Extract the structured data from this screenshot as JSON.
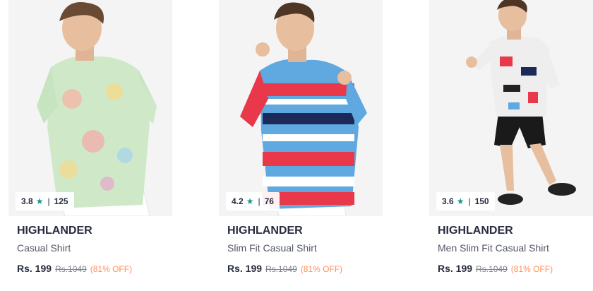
{
  "products": [
    {
      "brand": "HIGHLANDER",
      "name": "Casual Shirt",
      "rating": "3.8",
      "rating_count": "125",
      "price": "Rs. 199",
      "mrp": "Rs.1049",
      "discount": "(81% OFF)",
      "star_icon": "star-icon"
    },
    {
      "brand": "HIGHLANDER",
      "name": "Slim Fit Casual Shirt",
      "rating": "4.2",
      "rating_count": "76",
      "price": "Rs. 199",
      "mrp": "Rs.1049",
      "discount": "(81% OFF)",
      "star_icon": "star-icon"
    },
    {
      "brand": "HIGHLANDER",
      "name": "Men Slim Fit Casual Shirt",
      "rating": "3.6",
      "rating_count": "150",
      "price": "Rs. 199",
      "mrp": "Rs.1049",
      "discount": "(81% OFF)",
      "star_icon": "star-icon"
    }
  ],
  "colors": {
    "star": "#14958f",
    "discount": "#ff905a",
    "brand_text": "#282c3f",
    "name_text": "#535766",
    "mrp_text": "#7e818c"
  }
}
